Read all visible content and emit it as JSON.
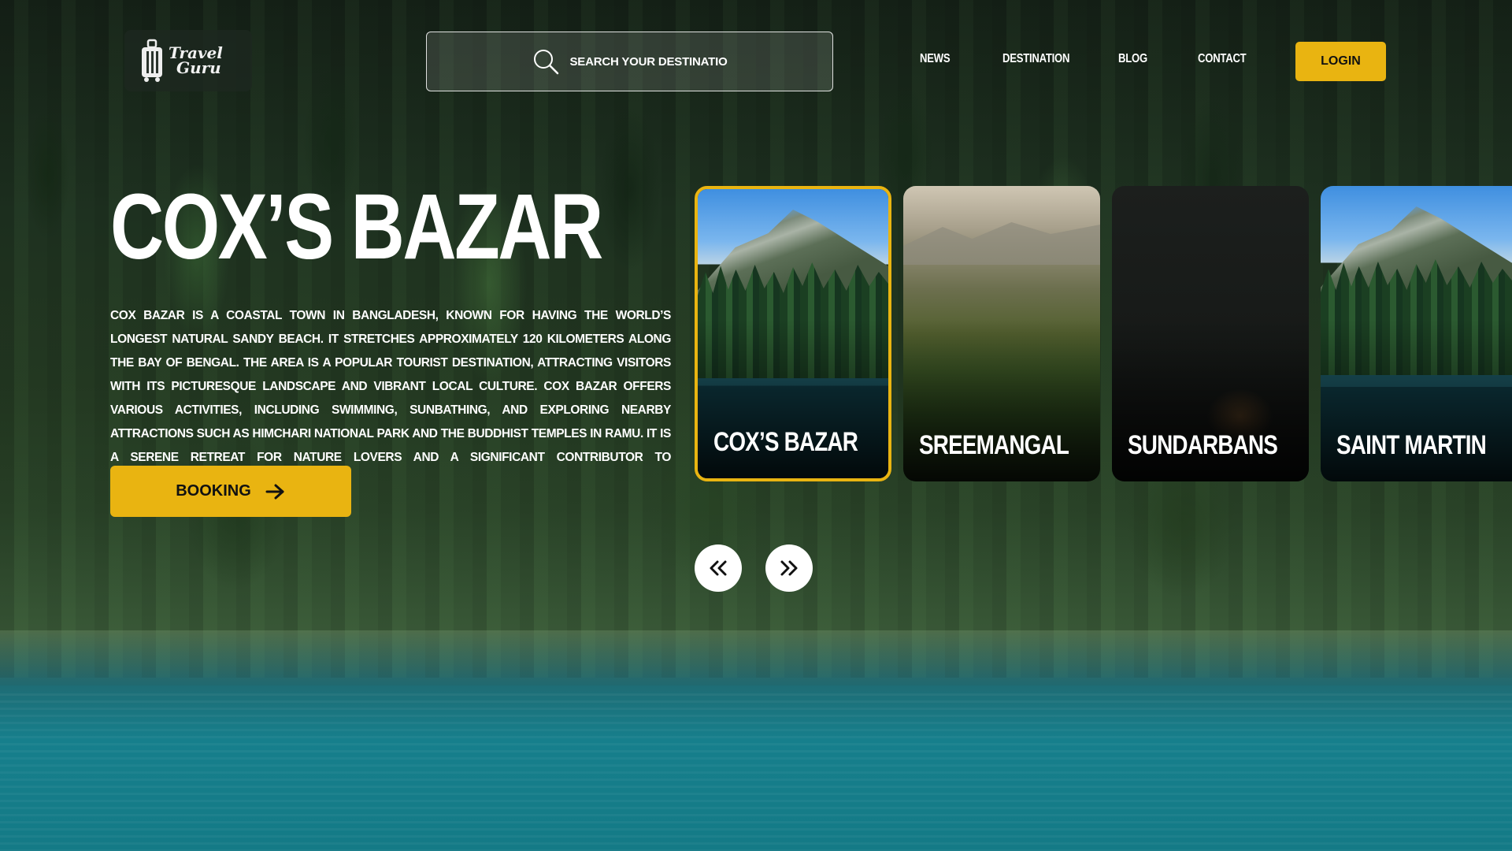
{
  "header": {
    "logo": {
      "line1": "Travel",
      "line2": "Guru"
    },
    "search": {
      "placeholder": "SEARCH YOUR DESTINATION ..."
    },
    "nav": [
      {
        "label": "NEWS"
      },
      {
        "label": "DESTINATION"
      },
      {
        "label": "BLOG"
      },
      {
        "label": "CONTACT"
      }
    ],
    "login_label": "LOGIN"
  },
  "hero": {
    "title": "COX’S BAZAR",
    "description": "COX BAZAR IS A COASTAL TOWN IN BANGLADESH, KNOWN FOR HAVING THE WORLD’S LONGEST NATURAL SANDY BEACH. IT STRETCHES APPROXIMATELY 120 KILOMETERS ALONG THE BAY OF BENGAL. THE AREA IS A POPULAR TOURIST DESTINATION, ATTRACTING VISITORS WITH ITS PICTURESQUE LANDSCAPE AND VIBRANT LOCAL CULTURE. COX BAZAR OFFERS VARIOUS ACTIVITIES, INCLUDING SWIMMING, SUNBATHING, AND EXPLORING NEARBY ATTRACTIONS SUCH AS HIMCHARI NATIONAL PARK AND THE BUDDHIST TEMPLES IN RAMU. IT IS A SERENE RETREAT FOR NATURE LOVERS AND A SIGNIFICANT CONTRIBUTOR TO BANGLADESH’S TOURISM INDUSTRY.",
    "booking_label": "BOOKING"
  },
  "destinations": [
    {
      "label": "COX’S BAZAR",
      "image": "mountain-lake",
      "active": true
    },
    {
      "label": "SREEMANGAL",
      "image": "tea-hills",
      "active": false
    },
    {
      "label": "SUNDARBANS",
      "image": "tiger-forest",
      "active": false
    },
    {
      "label": "SAINT MARTIN",
      "image": "mountain-lake",
      "active": false
    }
  ],
  "colors": {
    "accent": "#e9b411",
    "text": "#ffffff"
  },
  "icons": {
    "search": "search-icon",
    "booking": "arrow-right-icon",
    "prev": "double-chevron-left-icon",
    "next": "double-chevron-right-icon",
    "logo": "suitcase-icon"
  }
}
